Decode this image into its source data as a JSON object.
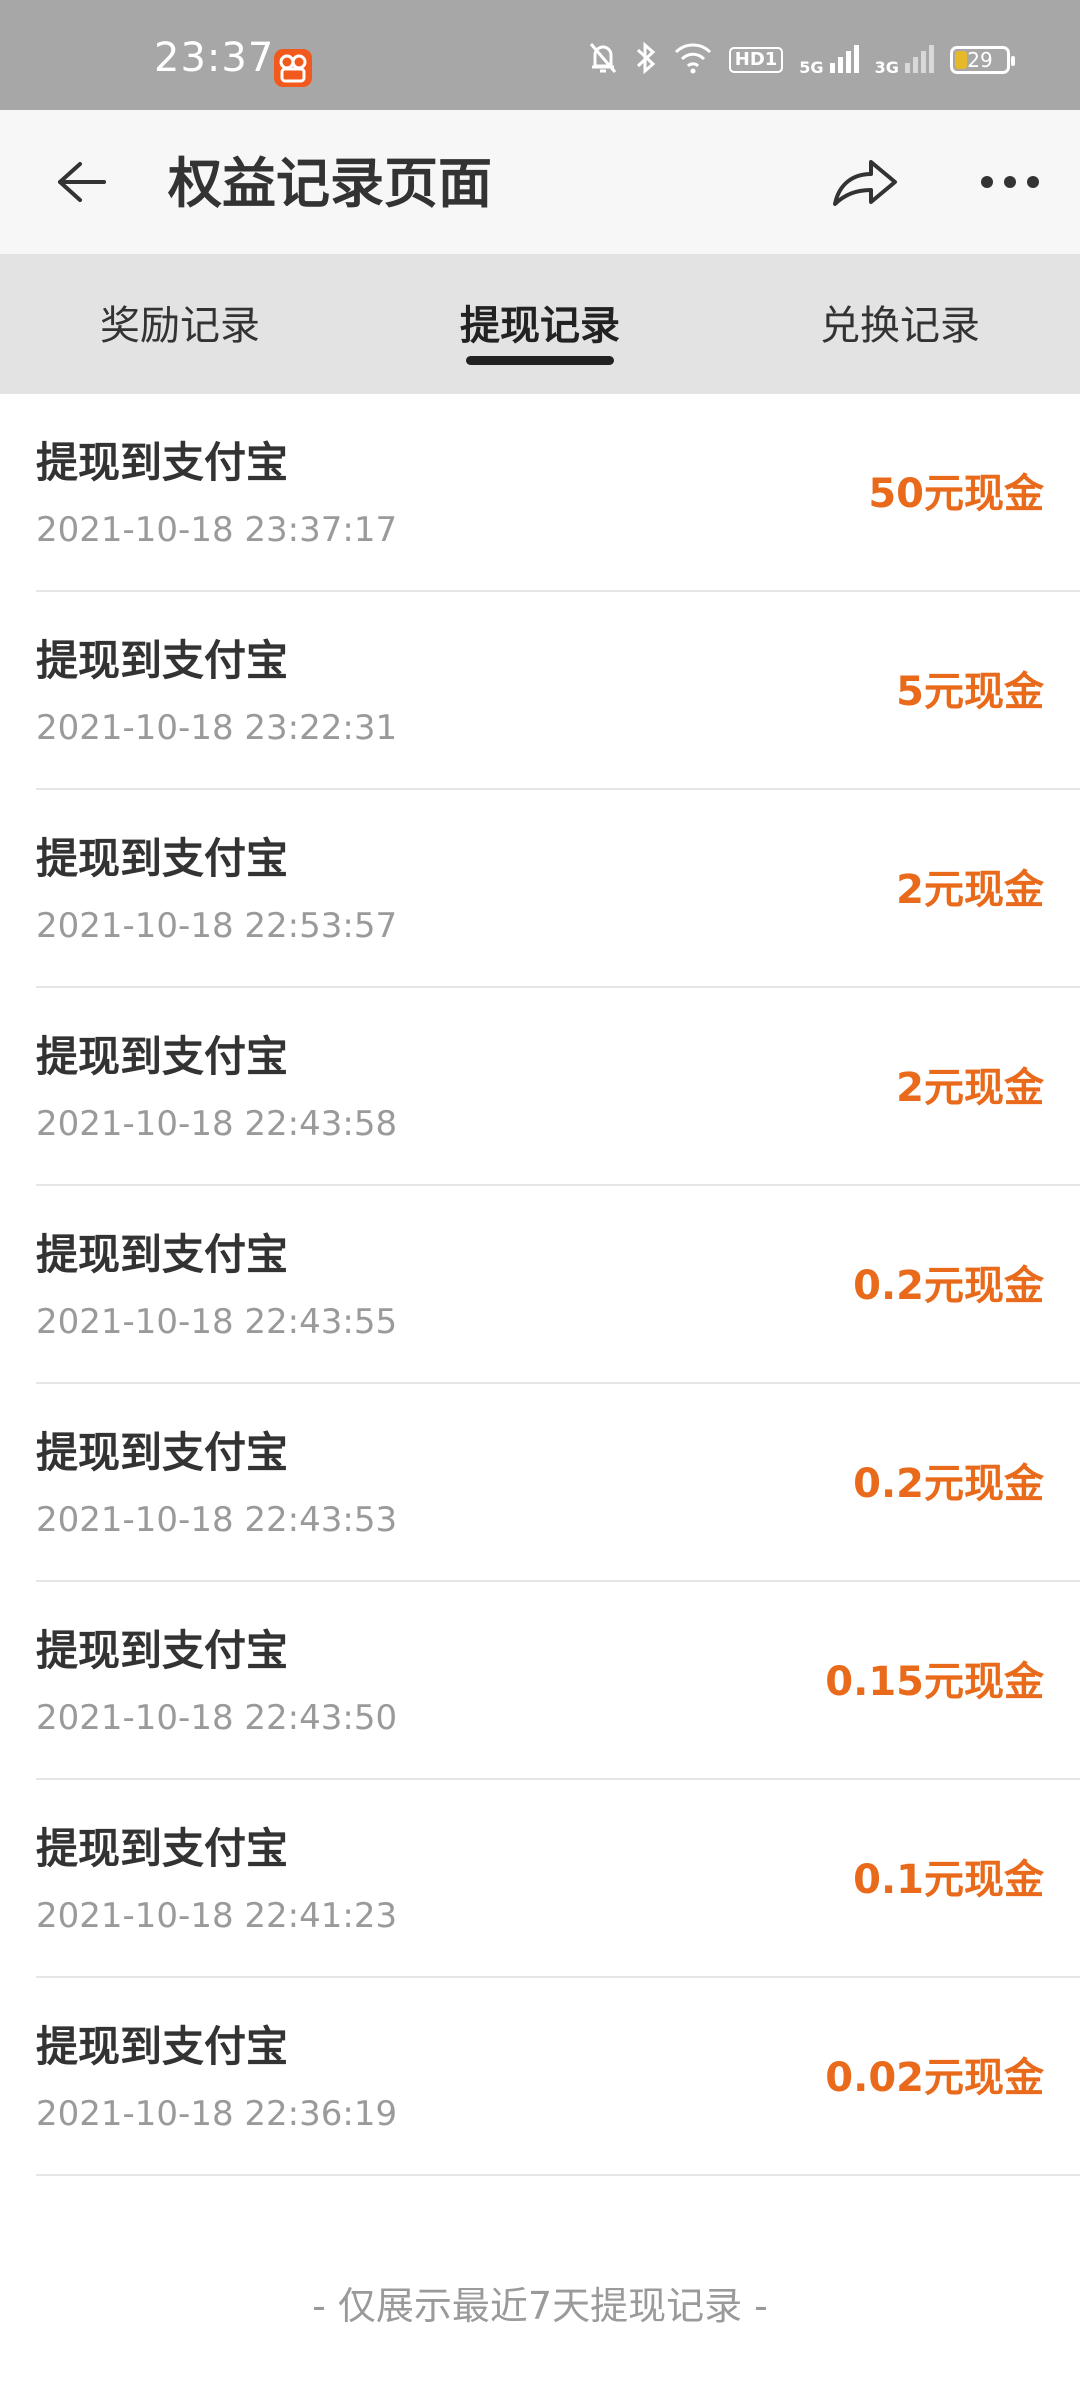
{
  "status_bar": {
    "time": "23:37",
    "net_hd": "HD1",
    "net_5g": "5G",
    "net_3g": "3G",
    "battery": "29"
  },
  "header": {
    "title": "权益记录页面"
  },
  "tabs": [
    {
      "label": "奖励记录",
      "active": false
    },
    {
      "label": "提现记录",
      "active": true
    },
    {
      "label": "兑换记录",
      "active": false
    }
  ],
  "records": [
    {
      "title": "提现到支付宝",
      "time": "2021-10-18 23:37:17",
      "amount": "50元现金"
    },
    {
      "title": "提现到支付宝",
      "time": "2021-10-18 23:22:31",
      "amount": "5元现金"
    },
    {
      "title": "提现到支付宝",
      "time": "2021-10-18 22:53:57",
      "amount": "2元现金"
    },
    {
      "title": "提现到支付宝",
      "time": "2021-10-18 22:43:58",
      "amount": "2元现金"
    },
    {
      "title": "提现到支付宝",
      "time": "2021-10-18 22:43:55",
      "amount": "0.2元现金"
    },
    {
      "title": "提现到支付宝",
      "time": "2021-10-18 22:43:53",
      "amount": "0.2元现金"
    },
    {
      "title": "提现到支付宝",
      "time": "2021-10-18 22:43:50",
      "amount": "0.15元现金"
    },
    {
      "title": "提现到支付宝",
      "time": "2021-10-18 22:41:23",
      "amount": "0.1元现金"
    },
    {
      "title": "提现到支付宝",
      "time": "2021-10-18 22:36:19",
      "amount": "0.02元现金"
    }
  ],
  "footer_note": "- 仅展示最近7天提现记录 -",
  "colors": {
    "accent_amount": "#e86a1a",
    "status_bar_bg": "#a7a7a7",
    "tab_bg": "#e3e3e3",
    "header_bg": "#f7f7f7"
  },
  "icons": {
    "back": "arrow-left-icon",
    "share": "share-icon",
    "more": "more-dots-icon",
    "mute": "bell-off-icon",
    "bluetooth": "bluetooth-icon",
    "wifi": "wifi-icon",
    "battery": "battery-icon"
  }
}
